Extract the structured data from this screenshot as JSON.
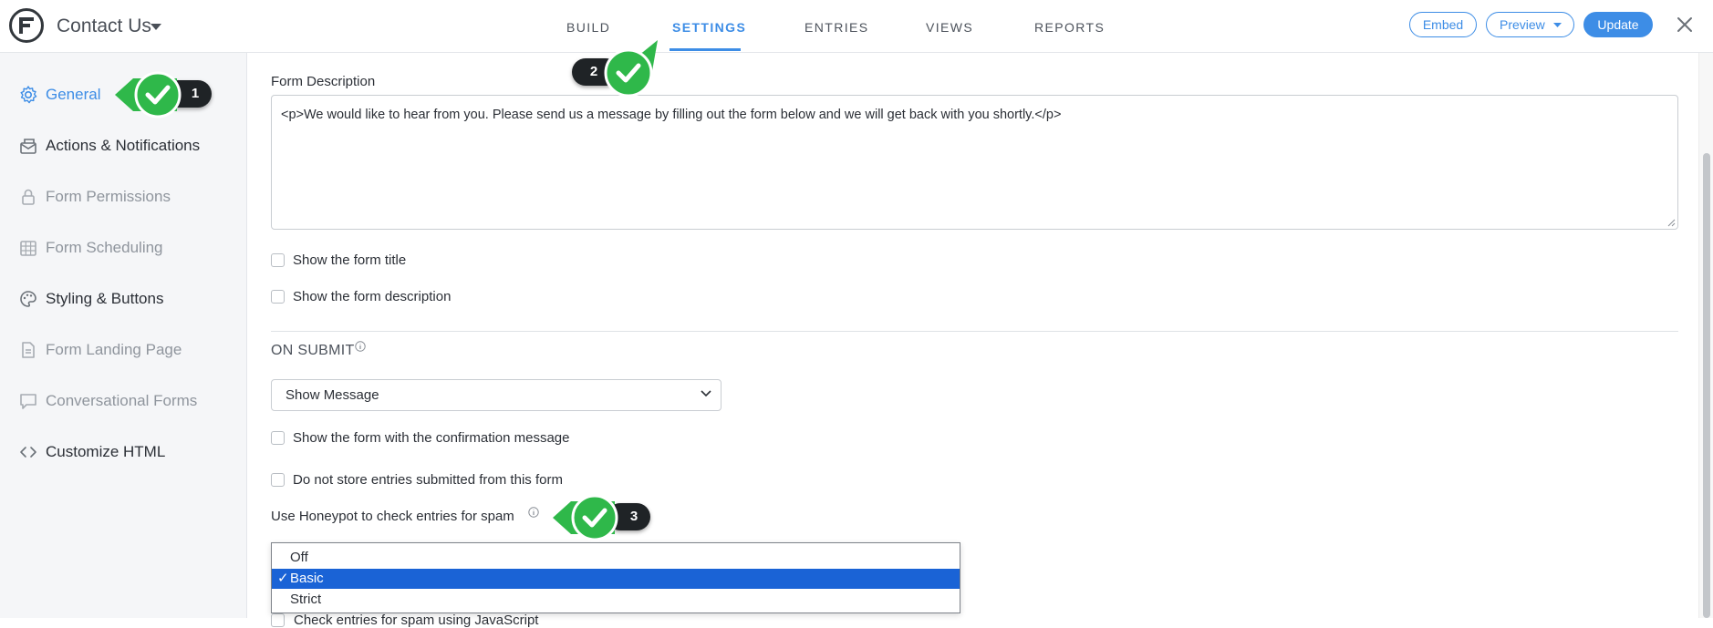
{
  "header": {
    "form_title": "Contact Us",
    "tabs": [
      {
        "label": "BUILD",
        "active": false
      },
      {
        "label": "SETTINGS",
        "active": true
      },
      {
        "label": "ENTRIES",
        "active": false
      },
      {
        "label": "VIEWS",
        "active": false
      },
      {
        "label": "REPORTS",
        "active": false
      }
    ],
    "embed_label": "Embed",
    "preview_label": "Preview",
    "update_label": "Update",
    "accent_color": "#3d8de6"
  },
  "sidebar": {
    "items": [
      {
        "label": "General",
        "icon": "gear-icon",
        "state": "active"
      },
      {
        "label": "Actions & Notifications",
        "icon": "notification-icon",
        "state": "dark"
      },
      {
        "label": "Form Permissions",
        "icon": "lock-icon",
        "state": "muted"
      },
      {
        "label": "Form Scheduling",
        "icon": "calendar-icon",
        "state": "muted"
      },
      {
        "label": "Styling & Buttons",
        "icon": "palette-icon",
        "state": "dark"
      },
      {
        "label": "Form Landing Page",
        "icon": "document-icon",
        "state": "muted"
      },
      {
        "label": "Conversational Forms",
        "icon": "chat-icon",
        "state": "muted"
      },
      {
        "label": "Customize HTML",
        "icon": "code-icon",
        "state": "dark"
      }
    ]
  },
  "main": {
    "form_description_label": "Form Description",
    "form_description_value": "<p>We would like to hear from you. Please send us a message by filling out the form below and we will get back with you shortly.</p>",
    "show_title_label": "Show the form title",
    "show_description_label": "Show the form description",
    "on_submit_heading": "ON SUBMIT",
    "on_submit_value": "Show Message",
    "show_form_with_confirmation_label": "Show the form with the confirmation message",
    "do_not_store_label": "Do not store entries submitted from this form",
    "honeypot_label": "Use Honeypot to check entries for spam",
    "honeypot_options": [
      "Off",
      "Basic",
      "Strict"
    ],
    "honeypot_selected": "Basic",
    "check_mark": "✓",
    "javascript_spam_label": "Check entries for spam using JavaScript"
  },
  "annotations": {
    "steps": [
      "1",
      "2",
      "3"
    ],
    "marker_color": "#2fb84a"
  }
}
